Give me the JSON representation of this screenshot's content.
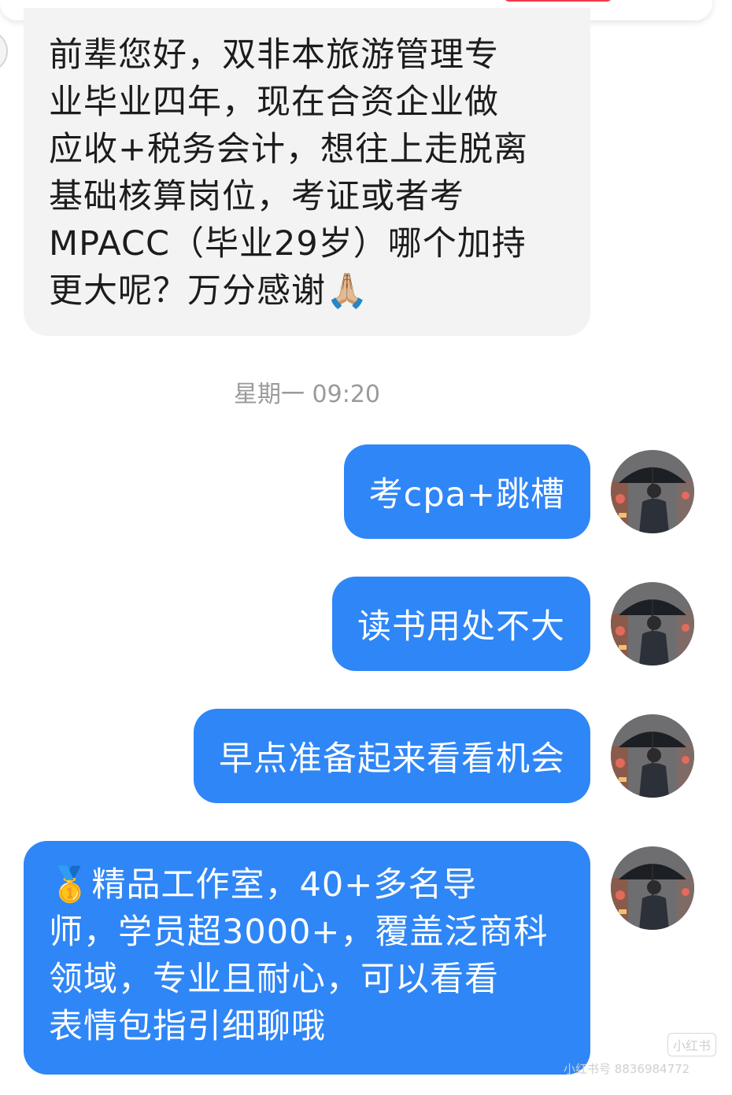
{
  "incoming_message": {
    "text": "前辈您好，双非本旅游管理专\n业毕业四年，现在合资企业做\n应收+税务会计，想往上走脱离\n基础核算岗位，考证或者考\nMPACC（毕业29岁）哪个加持\n更大呢？万分感谢🙏🏼"
  },
  "timestamp": "星期一 09:20",
  "outgoing_messages": [
    {
      "text": "考cpa+跳槽"
    },
    {
      "text": "读书用处不大"
    },
    {
      "text": "早点准备起来看看机会"
    },
    {
      "text": "🥇精品工作室，40+多名导\n师，学员超3000+，覆盖泛商科\n领域，专业且耐心，可以看看\n表情包指引细聊哦"
    }
  ],
  "watermark": {
    "logo": "小红书",
    "text": "小红书号 8836984772"
  },
  "colors": {
    "outgoing_bubble": "#2f86f7",
    "incoming_bubble": "#f3f3f3",
    "top_accent": "#f2384b"
  },
  "icons": {
    "avatar": "man-with-umbrella-avatar"
  }
}
